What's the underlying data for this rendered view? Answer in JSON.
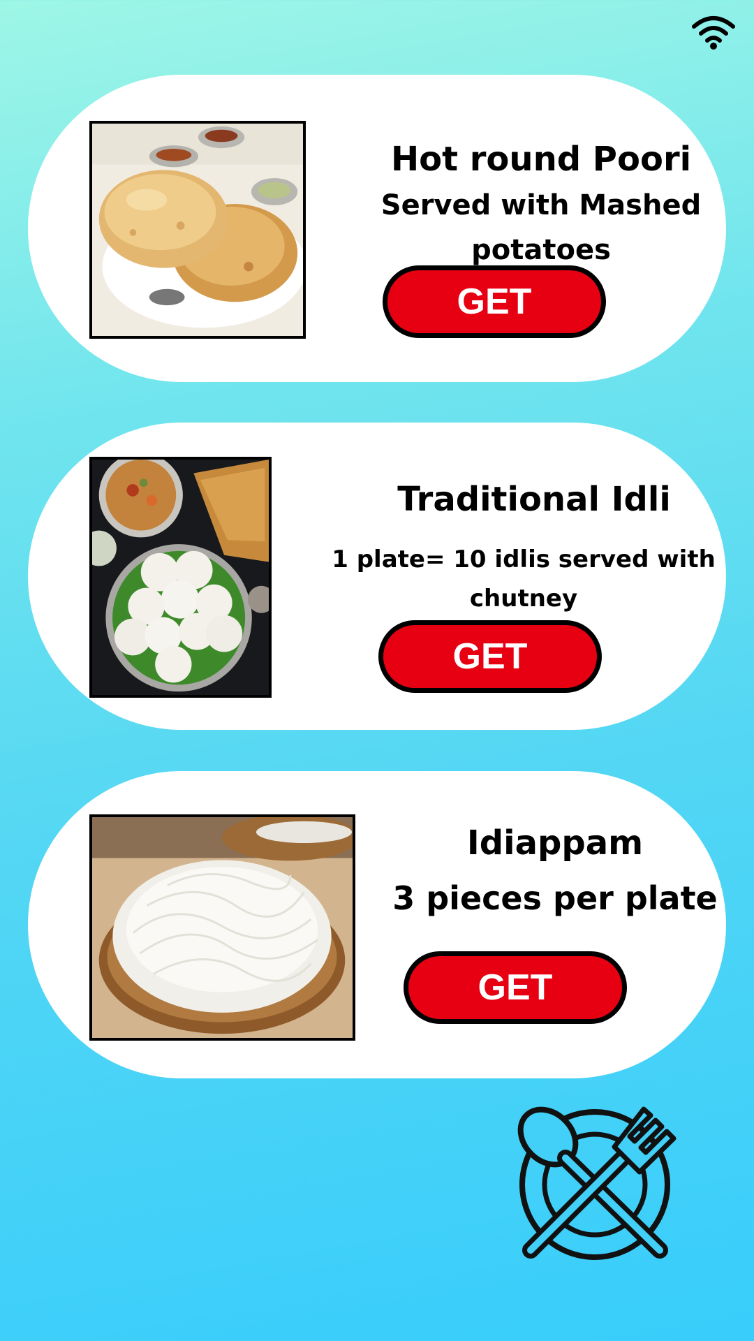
{
  "status_bar": {
    "wifi_icon": "wifi-icon"
  },
  "menu": {
    "items": [
      {
        "title": "Hot round Poori",
        "description": "Served with Mashed potatoes",
        "button_label": "GET",
        "photo": "poori-photo"
      },
      {
        "title": "Traditional Idli",
        "description": "1 plate= 10 idlis served with chutney",
        "button_label": "GET",
        "photo": "idli-photo"
      },
      {
        "title": "Idiappam",
        "description": "3 pieces per plate",
        "button_label": "GET",
        "photo": "idiappam-photo"
      }
    ]
  },
  "footer": {
    "icon": "spoon-fork-plate-icon"
  },
  "colors": {
    "background_top": "#9ef6e6",
    "background_bottom": "#38cdfb",
    "card": "#ffffff",
    "button": "#e60012",
    "button_text": "#ffffff"
  }
}
